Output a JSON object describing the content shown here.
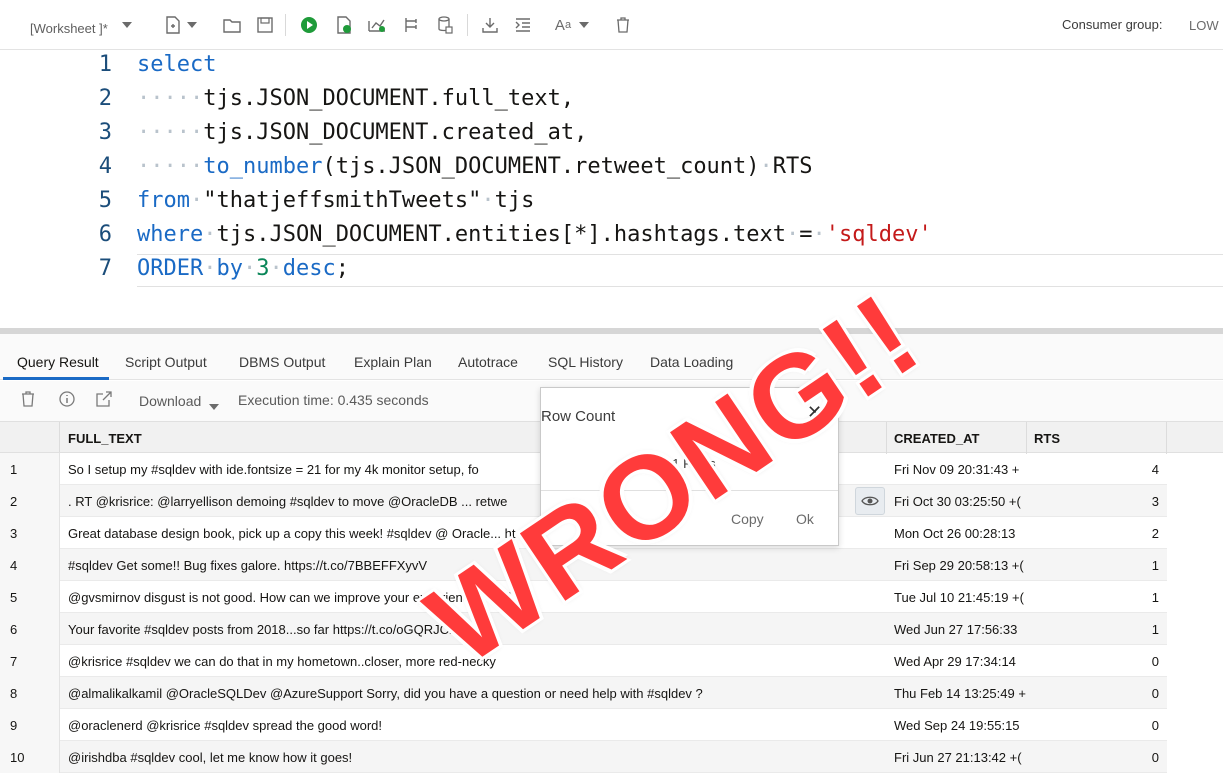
{
  "toolbar": {
    "worksheet_label": "[Worksheet ]*",
    "consumer_group_label": "Consumer group:",
    "consumer_group_value": "LOW"
  },
  "editor": {
    "line_numbers": [
      "1",
      "2",
      "3",
      "4",
      "5",
      "6",
      "7"
    ],
    "lines": [
      [
        {
          "t": "select",
          "c": "kw"
        }
      ],
      [
        {
          "t": "·····",
          "c": "ws"
        },
        {
          "t": "tjs.JSON_DOCUMENT.full_text,",
          "c": ""
        }
      ],
      [
        {
          "t": "·····",
          "c": "ws"
        },
        {
          "t": "tjs.JSON_DOCUMENT.created_at,",
          "c": ""
        }
      ],
      [
        {
          "t": "·····",
          "c": "ws"
        },
        {
          "t": "to_number",
          "c": "fn"
        },
        {
          "t": "(tjs.JSON_DOCUMENT.retweet_count)",
          "c": ""
        },
        {
          "t": "·",
          "c": "ws"
        },
        {
          "t": "RTS",
          "c": ""
        }
      ],
      [
        {
          "t": "from",
          "c": "kw"
        },
        {
          "t": "·",
          "c": "ws"
        },
        {
          "t": "\"thatjeffsmithTweets\"",
          "c": ""
        },
        {
          "t": "·",
          "c": "ws"
        },
        {
          "t": "tjs",
          "c": ""
        }
      ],
      [
        {
          "t": "where",
          "c": "kw"
        },
        {
          "t": "·",
          "c": "ws"
        },
        {
          "t": "tjs.JSON_DOCUMENT.entities[*].hashtags.text",
          "c": ""
        },
        {
          "t": "·",
          "c": "ws"
        },
        {
          "t": "=",
          "c": ""
        },
        {
          "t": "·",
          "c": "ws"
        },
        {
          "t": "'sqldev'",
          "c": "str"
        }
      ],
      [
        {
          "t": "ORDER",
          "c": "kw"
        },
        {
          "t": "·",
          "c": "ws"
        },
        {
          "t": "by",
          "c": "kw"
        },
        {
          "t": "·",
          "c": "ws"
        },
        {
          "t": "3",
          "c": "num"
        },
        {
          "t": "·",
          "c": "ws"
        },
        {
          "t": "desc",
          "c": "kw"
        },
        {
          "t": ";",
          "c": ""
        }
      ]
    ]
  },
  "tabs": {
    "items": [
      "Query Result",
      "Script Output",
      "DBMS Output",
      "Explain Plan",
      "Autotrace",
      "SQL History",
      "Data Loading"
    ],
    "active": "Query Result"
  },
  "results_toolbar": {
    "download_label": "Download",
    "execution_time": "Execution time: 0.435 seconds"
  },
  "grid": {
    "columns": [
      "FULL_TEXT",
      "CREATED_AT",
      "RTS"
    ],
    "rows": [
      {
        "n": "1",
        "full_text": "So I setup my #sqldev with ide.fontsize = 21 for my 4k monitor setup, fo",
        "created_at": "Fri Nov 09 20:31:43 +",
        "rts": "4"
      },
      {
        "n": "2",
        "full_text": ". RT @krisrice: @larryellison demoing #sqldev to move @OracleDB ... retwe",
        "created_at": "Fri Oct 30 03:25:50 +(",
        "rts": "3"
      },
      {
        "n": "3",
        "full_text": "Great database design book, pick up a copy this week! #sqldev @ Oracle... ht",
        "created_at": "Mon Oct 26 00:28:13",
        "rts": "2"
      },
      {
        "n": "4",
        "full_text": "#sqldev Get some!! Bug fixes galore. https://t.co/7BBEFFXyvV",
        "created_at": "Fri Sep 29 20:58:13 +(",
        "rts": "1"
      },
      {
        "n": "5",
        "full_text": "@gvsmirnov disgust is not good. How can we improve your experience? #sqldev",
        "created_at": "Tue Jul 10 21:45:19 +(",
        "rts": "1"
      },
      {
        "n": "6",
        "full_text": "Your favorite #sqldev posts from 2018...so far https://t.co/oGQRJCbDnF",
        "created_at": "Wed Jun 27 17:56:33",
        "rts": "1"
      },
      {
        "n": "7",
        "full_text": "@krisrice #sqldev we can do that in my hometown..closer, more red-necky",
        "created_at": "Wed Apr 29 17:34:14",
        "rts": "0"
      },
      {
        "n": "8",
        "full_text": "@almalikalkamil @OracleSQLDev @AzureSupport Sorry, did you have a question or need help with #sqldev ?",
        "created_at": "Thu Feb 14 13:25:49 +",
        "rts": "0"
      },
      {
        "n": "9",
        "full_text": "@oraclenerd @krisrice #sqldev spread the good word!",
        "created_at": "Wed Sep 24 19:55:15",
        "rts": "0"
      },
      {
        "n": "10",
        "full_text": "@irishdba #sqldev cool, let me know how it goes!",
        "created_at": "Fri Jun 27 21:13:42 +(",
        "rts": "0"
      }
    ]
  },
  "dialog": {
    "title": "Row Count",
    "body": "81 Rows",
    "copy_label": "Copy",
    "ok_label": "Ok"
  },
  "overlay": {
    "stamp_text": "WRONG!!",
    "stamp_color": "#ff3b3b"
  }
}
